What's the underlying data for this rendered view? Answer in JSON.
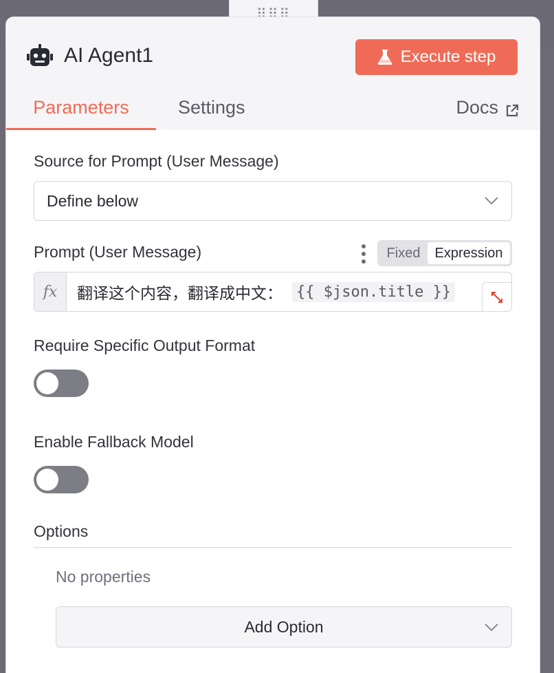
{
  "node": {
    "title": "AI Agent1",
    "icon": "robot-icon"
  },
  "toolbar": {
    "execute_label": "Execute step",
    "execute_icon": "flask-icon",
    "accent_color": "#f06b57"
  },
  "tabs": {
    "parameters": "Parameters",
    "settings": "Settings",
    "docs": "Docs"
  },
  "fields": {
    "source_label": "Source for Prompt (User Message)",
    "source_value": "Define below",
    "prompt_label": "Prompt (User Message)",
    "mode_fixed": "Fixed",
    "mode_expression": "Expression",
    "mode_selected": "Expression",
    "fx_symbol": "fx",
    "prompt_text": "翻译这个内容，翻译成中文：",
    "prompt_variable": "{{ $json.title }}",
    "output_format_label": "Require Specific Output Format",
    "output_format_enabled": false,
    "fallback_label": "Enable Fallback Model",
    "fallback_enabled": false
  },
  "options": {
    "heading": "Options",
    "empty_text": "No properties",
    "add_label": "Add Option"
  }
}
